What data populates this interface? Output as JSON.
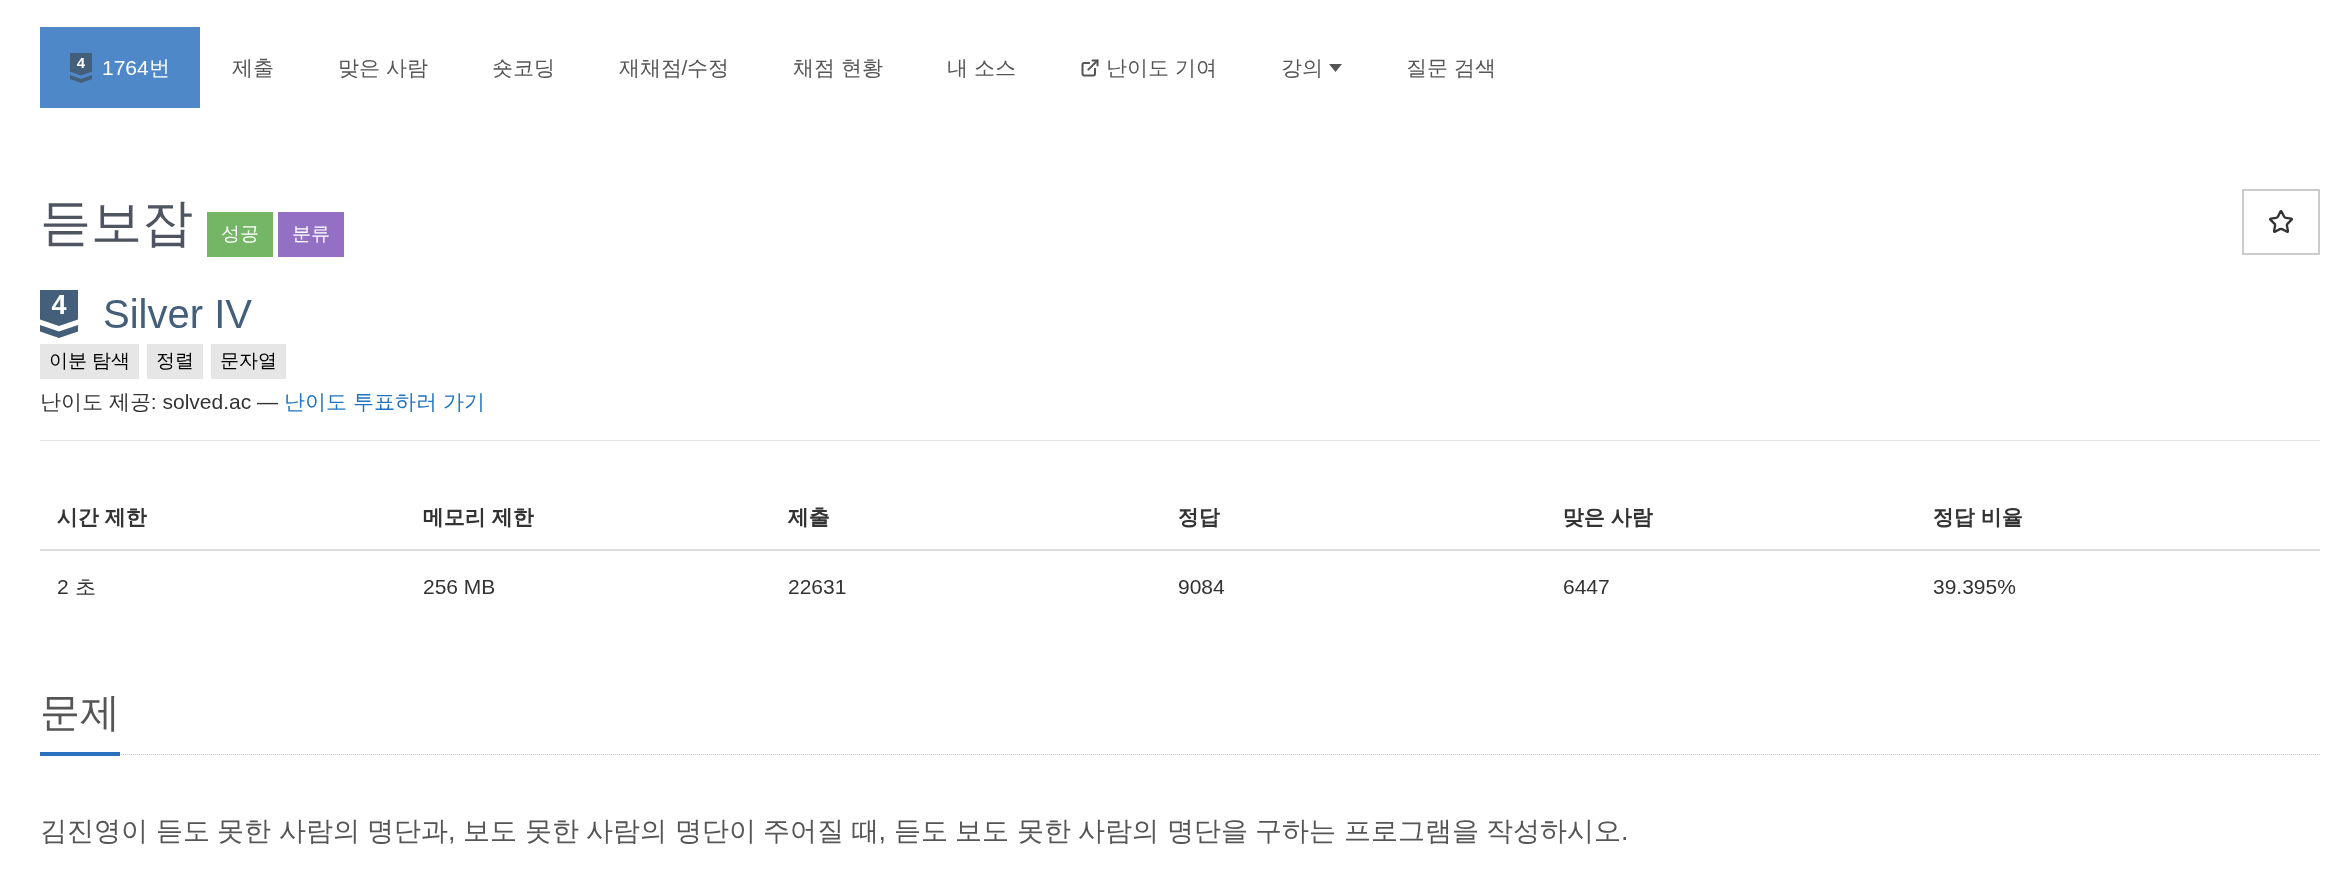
{
  "nav": {
    "items": [
      {
        "label": "1764번",
        "selected": true,
        "kind": "tier",
        "badge": "4"
      },
      {
        "label": "제출",
        "selected": false,
        "kind": "plain"
      },
      {
        "label": "맞은 사람",
        "selected": false,
        "kind": "plain"
      },
      {
        "label": "숏코딩",
        "selected": false,
        "kind": "plain"
      },
      {
        "label": "재채점/수정",
        "selected": false,
        "kind": "plain"
      },
      {
        "label": "채점 현황",
        "selected": false,
        "kind": "plain"
      },
      {
        "label": "내 소스",
        "selected": false,
        "kind": "plain"
      },
      {
        "label": "난이도 기여",
        "selected": false,
        "kind": "external"
      },
      {
        "label": "강의",
        "selected": false,
        "kind": "dropdown"
      },
      {
        "label": "질문 검색",
        "selected": false,
        "kind": "plain"
      }
    ]
  },
  "problem": {
    "title": "듣보잡",
    "labels": [
      {
        "text": "성공",
        "color": "#74b566"
      },
      {
        "text": "분류",
        "color": "#9370c4"
      }
    ],
    "tier": {
      "badge": "4",
      "name": "Silver IV"
    },
    "tags": [
      "이분 탐색",
      "정렬",
      "문자열"
    ],
    "difficulty_note": {
      "text": "난이도 제공: solved.ac —",
      "link": "난이도 투표하러 가기"
    }
  },
  "stats_table": {
    "columns": [
      "시간 제한",
      "메모리 제한",
      "제출",
      "정답",
      "맞은 사람",
      "정답 비율"
    ],
    "rows": [
      [
        "2 초",
        "256 MB",
        "22631",
        "9084",
        "6447",
        "39.395%"
      ]
    ]
  },
  "description": {
    "heading": "문제",
    "body": "김진영이 듣도 못한 사람의 명단과, 보도 못한 사람의 명단이 주어질 때, 듣도 보도 못한 사람의 명단을 구하는 프로그램을 작성하시오."
  }
}
